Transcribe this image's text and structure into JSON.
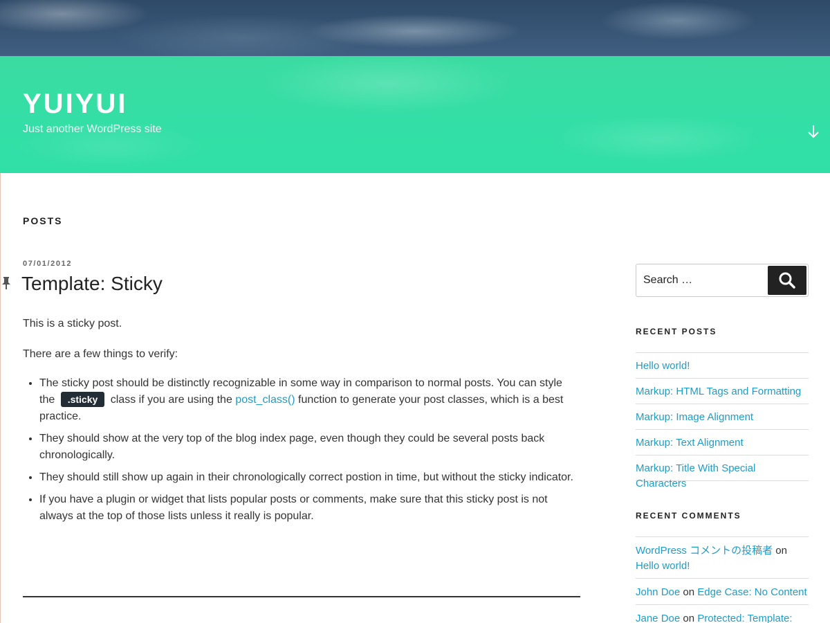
{
  "site": {
    "title": "YUIYUI",
    "description": "Just another WordPress site",
    "scroll_icon": "arrow-down-icon"
  },
  "colors": {
    "accent": "#1e9cc9",
    "header_band": "#33dfa6",
    "badge_bg": "#222d35"
  },
  "main": {
    "page_title": "POSTS",
    "post": {
      "date": "07/01/2012",
      "title": "Template: Sticky",
      "sticky_icon": "pushpin-icon",
      "para1": "This is a sticky post.",
      "para2": "There are a few things to verify:",
      "bullets": {
        "b1_pre": "The sticky post should be distinctly recognizable in some way in comparison to normal posts. You can style the",
        "b1_code": ".sticky",
        "b1_mid": "class if you are using the",
        "b1_link": "post_class()",
        "b1_post": "function to generate your post classes, which is a best practice.",
        "b2": "They should show at the very top of the blog index page, even though they could be several posts back chronologically.",
        "b3": "They should still show up again in their chronologically correct postion in time, but without the sticky indicator.",
        "b4": "If you have a plugin or widget that lists popular posts or comments, make sure that this sticky post is not always at the top of those lists unless it really is popular."
      }
    }
  },
  "sidebar": {
    "search": {
      "placeholder": "Search …",
      "button_icon": "search-icon"
    },
    "recent_posts": {
      "title": "RECENT POSTS",
      "items": [
        "Hello world!",
        "Markup: HTML Tags and Formatting",
        "Markup: Image Alignment",
        "Markup: Text Alignment",
        "Markup: Title With Special Characters"
      ]
    },
    "recent_comments": {
      "title": "RECENT COMMENTS",
      "on": "on",
      "items": [
        {
          "author": "WordPress コメントの投稿者",
          "post": "Hello world!"
        },
        {
          "author": "John Doe",
          "post": "Edge Case: No Content"
        },
        {
          "author": "Jane Doe",
          "post": "Protected: Template:"
        }
      ]
    }
  }
}
